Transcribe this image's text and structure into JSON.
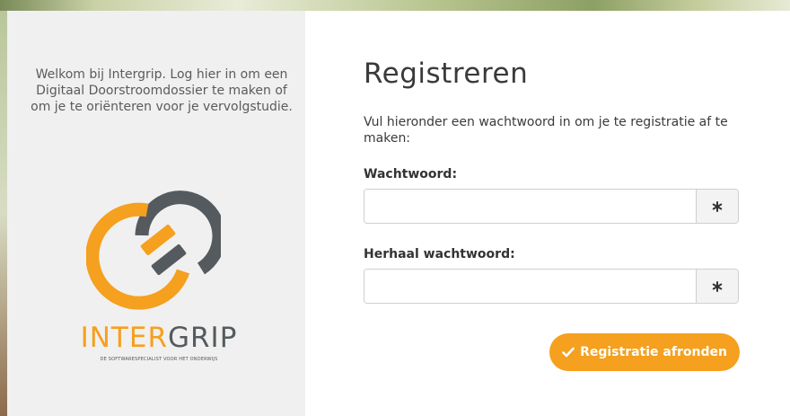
{
  "side_panel": {
    "welcome_text": "Welkom bij Intergrip. Log hier in om een Digitaal Doorstroomdossier te maken of om je te oriënteren voor je vervolgstudie.",
    "brand_part1": "INTER",
    "brand_part2": "GRIP",
    "tagline": "DE SOFTWARESPECIALIST VOOR HET ONDERWIJS"
  },
  "form": {
    "title": "Registreren",
    "intro": "Vul hieronder een wachtwoord in om je te registratie af te maken:",
    "password_label": "Wachtwoord:",
    "password_value": "",
    "password_toggle_icon": "asterisk-icon",
    "repeat_label": "Herhaal wachtwoord:",
    "repeat_value": "",
    "repeat_toggle_icon": "asterisk-icon",
    "submit_label": "Registratie afronden",
    "submit_icon": "checkmark-icon"
  },
  "colors": {
    "brand_orange": "#f5a01e",
    "brand_gray": "#555a5e",
    "panel_bg": "#f0f0f0"
  }
}
